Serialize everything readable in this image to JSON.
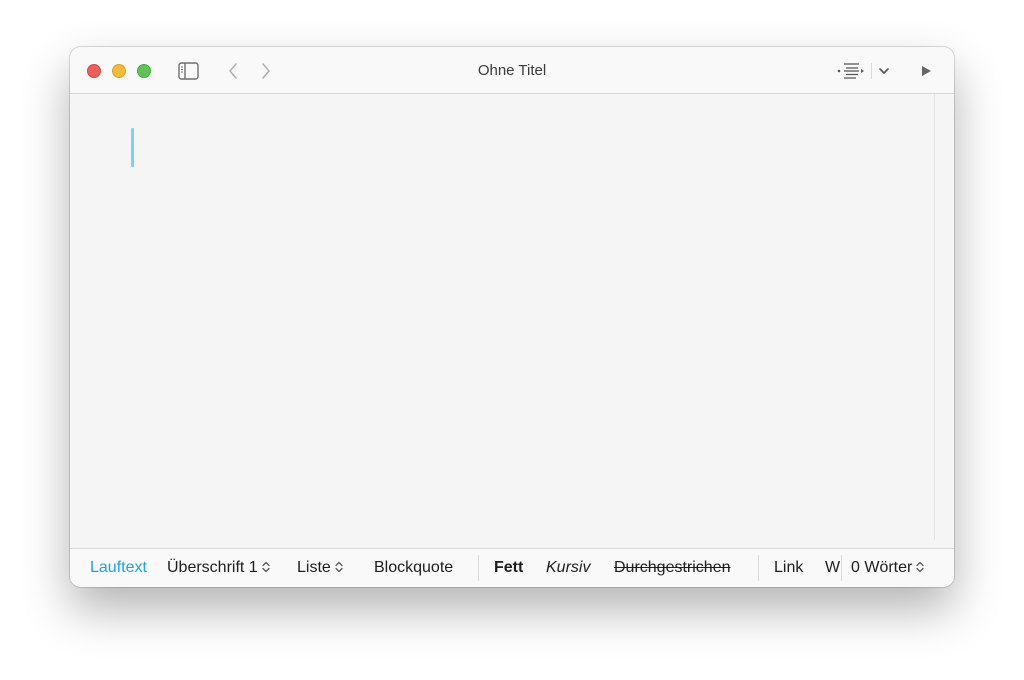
{
  "window": {
    "title": "Ohne Titel"
  },
  "toolbar": {
    "icons": [
      "sidebar-toggle-icon",
      "chevron-left-icon",
      "chevron-right-icon",
      "outline-icon",
      "chevron-down-icon",
      "play-icon"
    ]
  },
  "editor": {
    "content": "",
    "cursor_color": "#7fd0f5"
  },
  "bottom_bar": {
    "paragraph": "Lauftext",
    "heading": "Überschrift 1",
    "list": "Liste",
    "blockquote": "Blockquote",
    "bold": "Fett",
    "italic": "Kursiv",
    "strikethrough": "Durchgestrichen",
    "link": "Link",
    "truncated": "W",
    "word_count": "0 Wörter",
    "active_color": "#1aa3e8"
  }
}
